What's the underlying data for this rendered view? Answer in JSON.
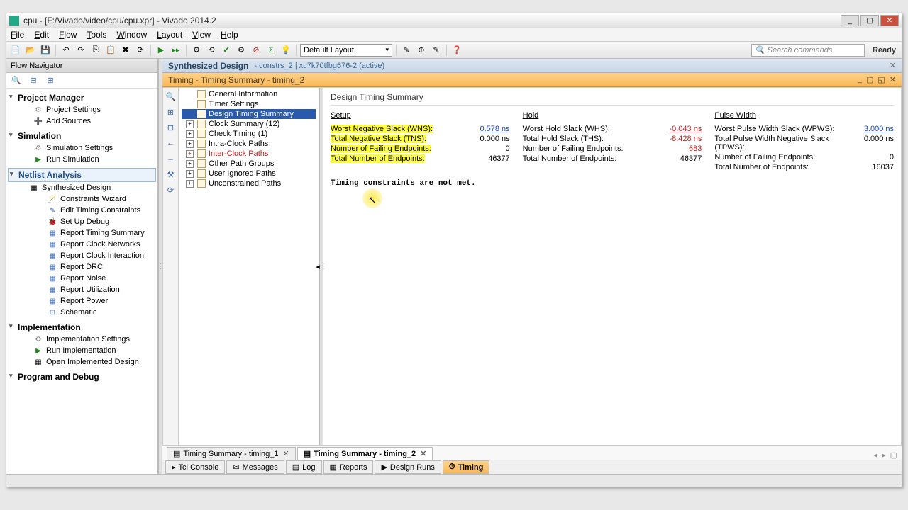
{
  "window": {
    "title": "cpu - [F:/Vivado/video/cpu/cpu.xpr] - Vivado 2014.2"
  },
  "menu": [
    "File",
    "Edit",
    "Flow",
    "Tools",
    "Window",
    "Layout",
    "View",
    "Help"
  ],
  "toolbar": {
    "layout": "Default Layout",
    "search_placeholder": "Search commands",
    "status": "Ready"
  },
  "flow_nav": {
    "title": "Flow Navigator",
    "sections": {
      "project_manager": {
        "title": "Project Manager",
        "items": [
          "Project Settings",
          "Add Sources"
        ]
      },
      "simulation": {
        "title": "Simulation",
        "items": [
          "Simulation Settings",
          "Run Simulation"
        ]
      },
      "netlist": {
        "title": "Netlist Analysis",
        "synth": "Synthesized Design",
        "items": [
          "Constraints Wizard",
          "Edit Timing Constraints",
          "Set Up Debug",
          "Report Timing Summary",
          "Report Clock Networks",
          "Report Clock Interaction",
          "Report DRC",
          "Report Noise",
          "Report Utilization",
          "Report Power",
          "Schematic"
        ]
      },
      "implementation": {
        "title": "Implementation",
        "items": [
          "Implementation Settings",
          "Run Implementation",
          "Open Implemented Design"
        ]
      },
      "program": {
        "title": "Program and Debug"
      }
    }
  },
  "synth_header": {
    "title": "Synthesized Design",
    "sub": "- constrs_2 | xc7k70tfbg676-2  (active)"
  },
  "timing_header": {
    "title": "Timing - Timing Summary - timing_2"
  },
  "tree": {
    "items": [
      {
        "label": "General Information",
        "red": false,
        "exp": false
      },
      {
        "label": "Timer Settings",
        "red": false,
        "exp": false
      },
      {
        "label": "Design Timing Summary",
        "red": false,
        "exp": false,
        "selected": true
      },
      {
        "label": "Clock Summary (12)",
        "red": false,
        "exp": true
      },
      {
        "label": "Check Timing (1)",
        "red": false,
        "exp": true
      },
      {
        "label": "Intra-Clock Paths",
        "red": false,
        "exp": true
      },
      {
        "label": "Inter-Clock Paths",
        "red": true,
        "exp": true
      },
      {
        "label": "Other Path Groups",
        "red": false,
        "exp": true
      },
      {
        "label": "User Ignored Paths",
        "red": false,
        "exp": true
      },
      {
        "label": "Unconstrained Paths",
        "red": false,
        "exp": true
      }
    ]
  },
  "summary": {
    "title": "Design Timing Summary",
    "setup": {
      "head": "Setup",
      "rows": [
        {
          "label": "Worst Negative Slack (WNS):",
          "val": "0.578 ns",
          "cls": "val-link",
          "hl": true
        },
        {
          "label": "Total Negative Slack (TNS):",
          "val": "0.000 ns",
          "hl": true
        },
        {
          "label": "Number of Failing Endpoints:",
          "val": "0",
          "hl": true
        },
        {
          "label": "Total Number of Endpoints:",
          "val": "46377",
          "hl": true
        }
      ]
    },
    "hold": {
      "head": "Hold",
      "rows": [
        {
          "label": "Worst Hold Slack (WHS):",
          "val": "-0.043 ns",
          "cls": "val-link val-red"
        },
        {
          "label": "Total Hold Slack (THS):",
          "val": "-8.428 ns",
          "cls": "val-red"
        },
        {
          "label": "Number of Failing Endpoints:",
          "val": "683",
          "cls": "val-red"
        },
        {
          "label": "Total Number of Endpoints:",
          "val": "46377"
        }
      ]
    },
    "pulse": {
      "head": "Pulse Width",
      "rows": [
        {
          "label": "Worst Pulse Width Slack (WPWS):",
          "val": "3.000 ns",
          "cls": "val-link"
        },
        {
          "label": "Total Pulse Width Negative Slack (TPWS):",
          "val": "0.000 ns"
        },
        {
          "label": "Number of Failing Endpoints:",
          "val": "0"
        },
        {
          "label": "Total Number of Endpoints:",
          "val": "16037"
        }
      ]
    },
    "constraints_msg": "Timing constraints are not met."
  },
  "result_tabs": [
    {
      "label": "Timing Summary - timing_1",
      "active": false
    },
    {
      "label": "Timing Summary - timing_2",
      "active": true
    }
  ],
  "bottom_tabs": [
    {
      "label": "Tcl Console",
      "icon": "▸"
    },
    {
      "label": "Messages",
      "icon": "✉"
    },
    {
      "label": "Log",
      "icon": "▤"
    },
    {
      "label": "Reports",
      "icon": "▦"
    },
    {
      "label": "Design Runs",
      "icon": "▶"
    },
    {
      "label": "Timing",
      "icon": "⏱",
      "active": true
    }
  ]
}
